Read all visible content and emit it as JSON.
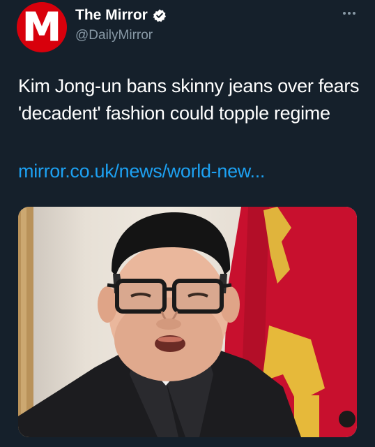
{
  "tweet": {
    "author": {
      "avatar_letter": "M",
      "display_name": "The Mirror",
      "handle": "@DailyMirror",
      "verified": true,
      "avatar_color": "#d8000c"
    },
    "text": "Kim Jong-un bans skinny jeans over fears 'decadent' fashion could topple regime",
    "link": "mirror.co.uk/news/world-new...",
    "icons": {
      "more": "more-options-icon",
      "verified": "verified-badge-icon"
    },
    "colors": {
      "background": "#15202b",
      "link": "#1da1f2",
      "secondary_text": "#8899a6",
      "verified": "#ffffff"
    }
  }
}
